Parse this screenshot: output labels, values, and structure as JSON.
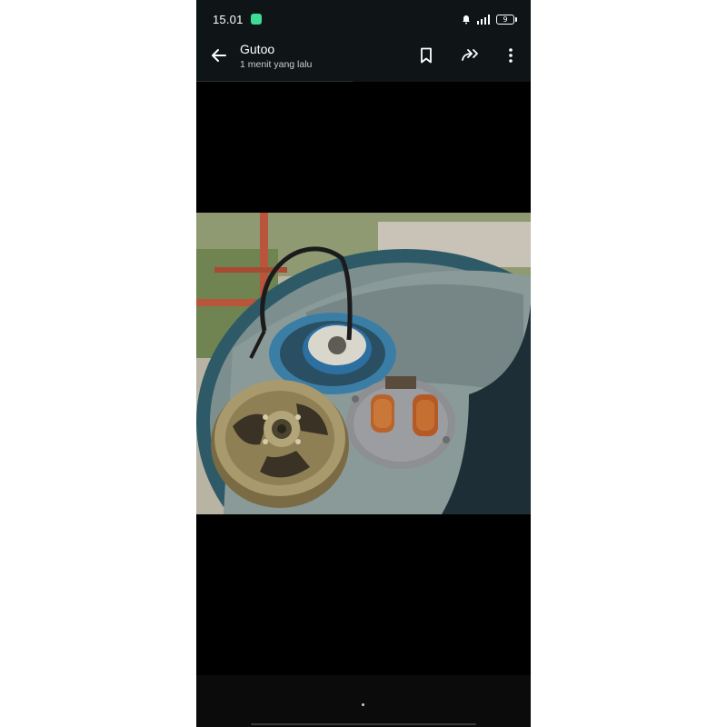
{
  "status_bar": {
    "time": "15.01",
    "battery": "9",
    "icons": [
      "app-notification-icon",
      "bell-icon",
      "signal-icon",
      "battery-icon"
    ]
  },
  "toolbar": {
    "contact_name": "Gutoo",
    "timestamp": "1 menit yang lalu",
    "icons": [
      "back-arrow-icon",
      "bookmark-icon",
      "forward-icon",
      "more-vertical-icon"
    ]
  },
  "colors": {
    "toolbar_bg": "#0f1416",
    "viewer_bg": "#000000",
    "page_bg": "#ffffff"
  }
}
